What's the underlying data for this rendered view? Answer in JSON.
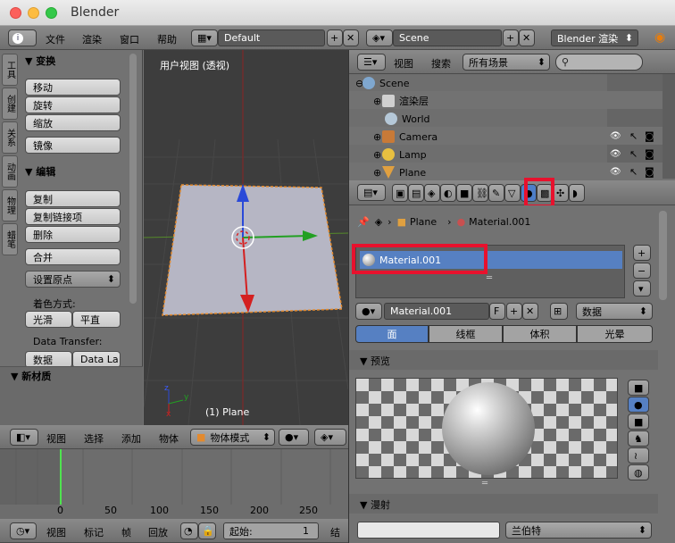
{
  "window": {
    "title": "Blender"
  },
  "info": {
    "menus": [
      "文件",
      "渲染",
      "窗口",
      "帮助"
    ],
    "layout": "Default",
    "scene": "Scene",
    "engine": "Blender 渲染"
  },
  "toolshelf": {
    "tabs": [
      "工具",
      "创建",
      "关系",
      "动画",
      "物理",
      "蜡笔"
    ],
    "transform": {
      "title": "变换",
      "buttons": [
        "移动",
        "旋转",
        "缩放",
        "镜像"
      ]
    },
    "edit": {
      "title": "编辑",
      "buttons": [
        "复制",
        "复制链接项",
        "删除",
        "合并"
      ],
      "origin": "设置原点"
    },
    "shading": {
      "label": "着色方式:",
      "smooth": "光滑",
      "flat": "平直"
    },
    "transfer": {
      "label": "Data Transfer:",
      "data": "数据",
      "data_layout": "Data La"
    },
    "new_material": "新材质"
  },
  "viewport": {
    "label": "用户视图 (透视)",
    "object_label": "(1) Plane",
    "axis_z": "z",
    "axis_x": "x",
    "axis_y": "y"
  },
  "view3d_header": {
    "menus": [
      "视图",
      "选择",
      "添加",
      "物体"
    ],
    "mode": "物体模式"
  },
  "timeline": {
    "ticks": [
      "0",
      "50",
      "100",
      "150",
      "200",
      "250"
    ],
    "menus": [
      "视图",
      "标记",
      "帧",
      "回放"
    ],
    "start_label": "起始:",
    "start_value": "1",
    "end_label": "结"
  },
  "outliner": {
    "menus": [
      "视图",
      "搜索"
    ],
    "filter": "所有场景",
    "rows": [
      "Scene",
      "渲染层",
      "World",
      "Camera",
      "Lamp",
      "Plane"
    ]
  },
  "properties": {
    "breadcrumb": [
      "Plane",
      "Material.001"
    ],
    "slot": "Material.001",
    "material_name": "Material.001",
    "f": "F",
    "link": "数据",
    "tabs": [
      "面",
      "线框",
      "体积",
      "光晕"
    ],
    "preview": "预览",
    "diffuse": "漫射",
    "shader": "兰伯特"
  }
}
